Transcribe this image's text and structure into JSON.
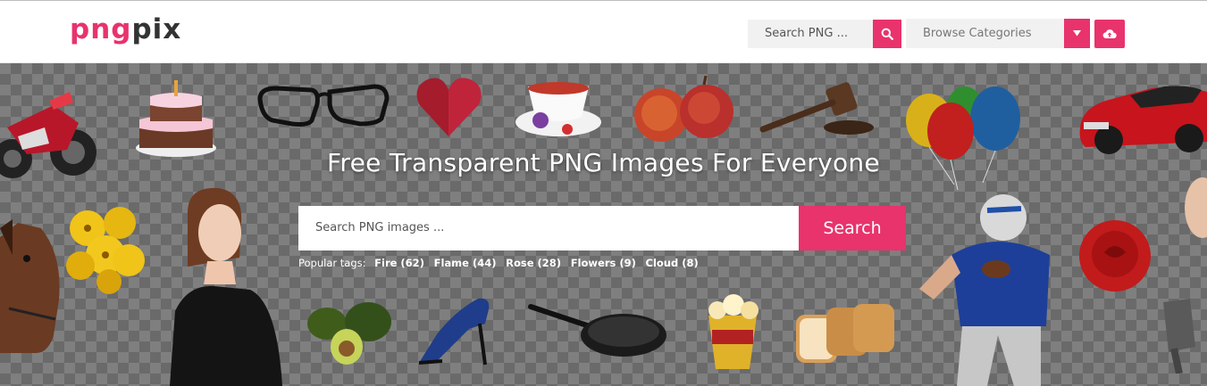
{
  "header": {
    "logo": {
      "part1": "png",
      "part2": "pix"
    },
    "search_placeholder": "Search PNG ...",
    "search_icon": "search-icon",
    "browse_label": "Browse Categories",
    "browse_icon": "caret-down-icon",
    "upload_icon": "cloud-upload-icon"
  },
  "hero": {
    "title": "Free Transparent PNG Images For Everyone",
    "search_placeholder": "Search PNG images ...",
    "search_button": "Search",
    "popular_label": "Popular tags:",
    "tags": [
      {
        "label": "Fire (62)"
      },
      {
        "label": "Flame (44)"
      },
      {
        "label": "Rose (28)"
      },
      {
        "label": "Flowers (9)"
      },
      {
        "label": "Cloud (8)"
      }
    ],
    "images": [
      "motorcycle",
      "cake",
      "glasses",
      "heart",
      "tea-cup",
      "apples",
      "gavel",
      "balloons",
      "car",
      "flowers",
      "woman",
      "horse",
      "avocado",
      "high-heel",
      "frying-pan",
      "popcorn",
      "bread",
      "football-player",
      "rose",
      "dumbbell",
      "person-edge"
    ]
  },
  "colors": {
    "accent": "#e8336d",
    "dark": "#333333",
    "field": "#f1f1f1"
  }
}
